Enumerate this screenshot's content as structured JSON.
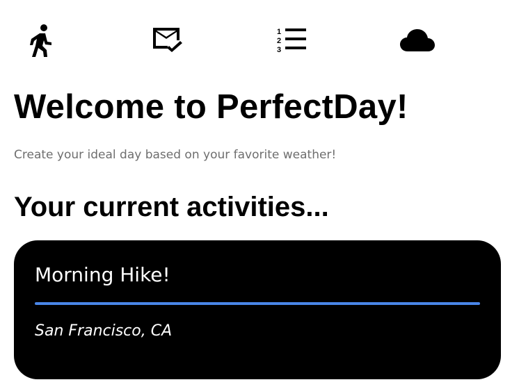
{
  "nav": {
    "items": [
      {
        "icon": "running-icon",
        "name": "activities"
      },
      {
        "icon": "mail-check-icon",
        "name": "inbox"
      },
      {
        "icon": "numbered-list-icon",
        "name": "list"
      },
      {
        "icon": "cloud-icon",
        "name": "weather"
      }
    ]
  },
  "header": {
    "title": "Welcome to PerfectDay!",
    "subtitle": "Create your ideal day based on your favorite weather!"
  },
  "activities": {
    "heading": "Your current activities...",
    "items": [
      {
        "title": "Morning Hike!",
        "location": "San Francisco, CA"
      }
    ]
  },
  "colors": {
    "card_background": "#000000",
    "accent": "#4a86e8"
  }
}
